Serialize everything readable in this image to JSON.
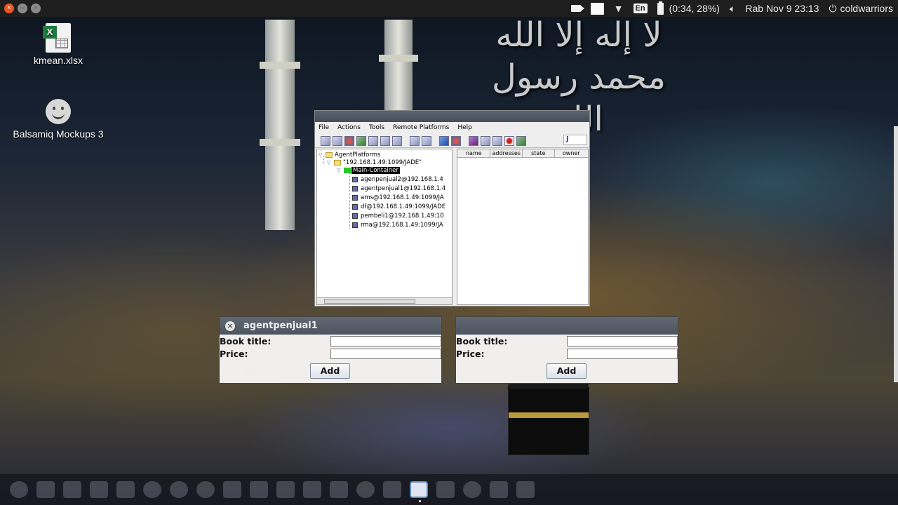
{
  "top_panel": {
    "battery": "(0:34, 28%)",
    "clock": "Rab Nov  9 23:13",
    "user": "coldwarriors",
    "language": "En"
  },
  "desktop": {
    "icons": [
      {
        "label": "kmean.xlsx"
      },
      {
        "label": "Balsamiq Mockups 3"
      }
    ]
  },
  "wallpaper": {
    "calligraphy": "لا إله إلا الله محمد رسول الله"
  },
  "jade": {
    "menu": [
      "File",
      "Actions",
      "Tools",
      "Remote Platforms",
      "Help"
    ],
    "tree": {
      "root": "AgentPlatforms",
      "platform": "\"192.168.1.49:1099/JADE\"",
      "container": "Main-Container",
      "agents": [
        "agenpenjual2@192.168.1.4",
        "agentpenjual1@192.168.1.4",
        "ams@192.168.1.49:1099/JA",
        "df@192.168.1.49:1099/JADE",
        "pembeli1@192.168.1.49:10",
        "rma@192.168.1.49:1099/JA"
      ]
    },
    "table_headers": [
      "name",
      "addresses",
      "state",
      "owner"
    ]
  },
  "form1": {
    "title": "agentpenjual1",
    "book_label": "Book title:",
    "price_label": "Price:",
    "book_value": "",
    "price_value": "",
    "add_label": "Add"
  },
  "form2": {
    "title": "",
    "book_label": "Book title:",
    "price_label": "Price:",
    "book_value": "",
    "price_value": "",
    "add_label": "Add"
  }
}
